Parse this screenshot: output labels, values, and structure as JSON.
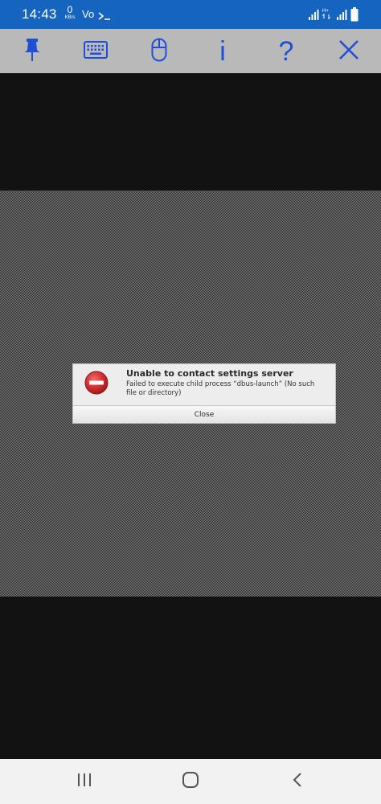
{
  "status_bar": {
    "time": "14:43",
    "net_speed_value": "0",
    "net_speed_unit": "KB/s",
    "volte_label": "Vo",
    "icons": [
      "terminal-prompt-icon",
      "signal-icon",
      "data-arrows-icon",
      "signal-icon",
      "battery-icon"
    ]
  },
  "toolbar": {
    "buttons": [
      {
        "name": "pin",
        "icon": "pin-icon"
      },
      {
        "name": "keyboard",
        "icon": "keyboard-icon"
      },
      {
        "name": "mouse",
        "icon": "mouse-icon"
      },
      {
        "name": "info",
        "icon": "info-icon",
        "glyph": "i"
      },
      {
        "name": "help",
        "icon": "help-icon",
        "glyph": "?"
      },
      {
        "name": "close",
        "icon": "close-icon"
      }
    ],
    "accent_color": "#1f4fd6",
    "background": "#b9b9b9"
  },
  "dialog": {
    "icon": "error-icon",
    "title": "Unable to contact settings server",
    "message_line1": "Failed to execute child process “dbus-launch” (No such",
    "message_line2": "file or directory)",
    "close_label": "Close"
  },
  "nav_bar": {
    "buttons": [
      "recent-apps-icon",
      "home-icon",
      "back-icon"
    ]
  },
  "colors": {
    "status_bar": "#1565c0",
    "desktop_background": "#121212",
    "error_red": "#d32f2f"
  }
}
